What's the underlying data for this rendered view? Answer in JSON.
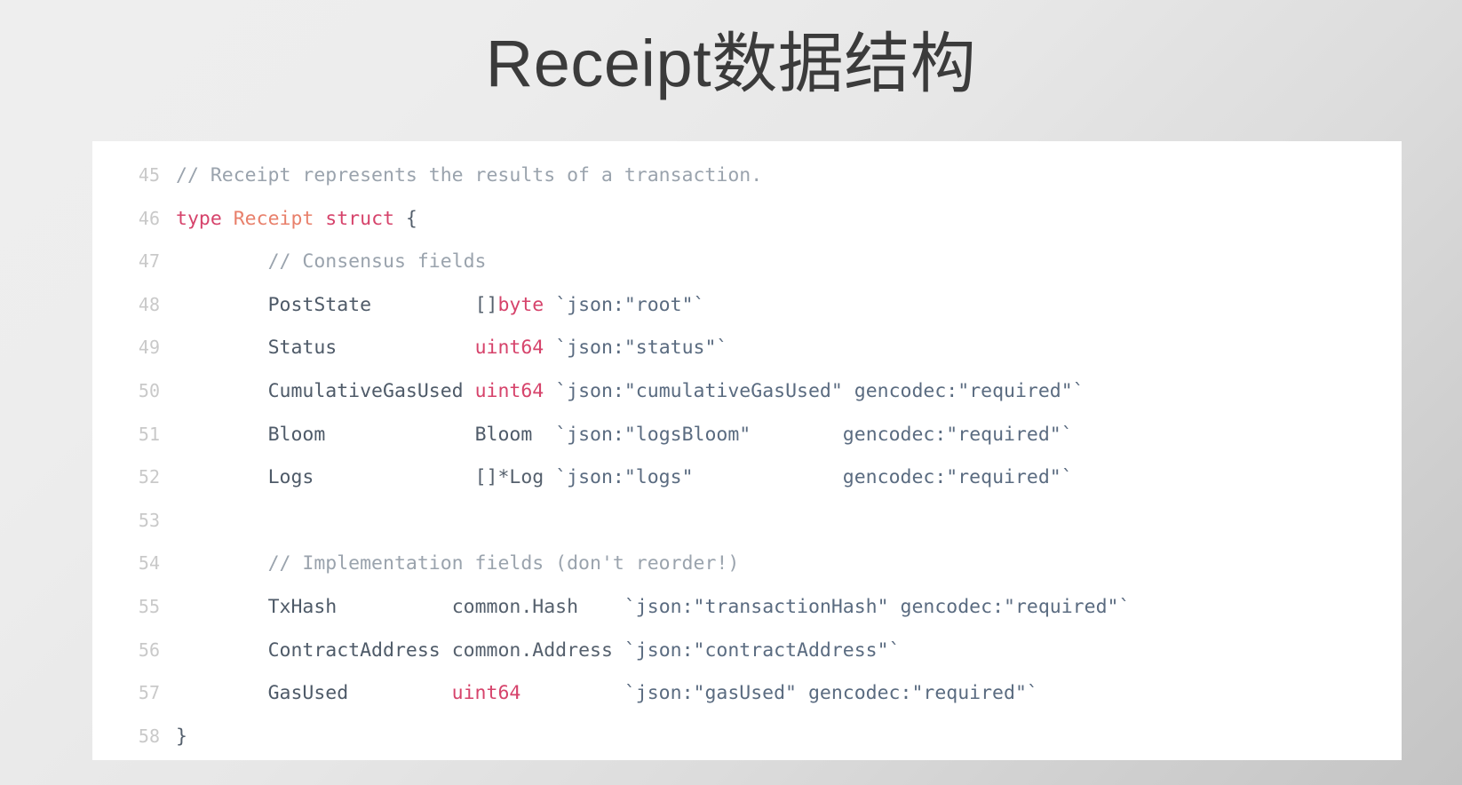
{
  "slide": {
    "title": "Receipt数据结构",
    "title_color": "#3b3b3b",
    "background_from": "#eeeeee",
    "background_to": "#c4c4c4"
  },
  "code_block": {
    "language": "go",
    "panel_color": "#ffffff",
    "gutter_color": "#c9c9c9",
    "colors": {
      "comment": "#9aa3ad",
      "keyword": "#d6436b",
      "type": "#d6436b",
      "field": "#e8806b",
      "string": "#5a6b80",
      "punct": "#55606d"
    },
    "first_line_number": 45,
    "lines": [
      {
        "number": "45",
        "text": "// Receipt represents the results of a transaction.",
        "tokens": [
          {
            "t": "// Receipt represents the results of a transaction.",
            "c": "comment"
          }
        ]
      },
      {
        "number": "46",
        "text": "type Receipt struct {",
        "tokens": [
          {
            "t": "type",
            "c": "keyword"
          },
          {
            "t": " ",
            "c": "plain"
          },
          {
            "t": "Receipt",
            "c": "name"
          },
          {
            "t": " ",
            "c": "plain"
          },
          {
            "t": "struct",
            "c": "keyword"
          },
          {
            "t": " ",
            "c": "plain"
          },
          {
            "t": "{",
            "c": "punct"
          }
        ]
      },
      {
        "number": "47",
        "text": "        // Consensus fields",
        "tokens": [
          {
            "t": "        ",
            "c": "plain"
          },
          {
            "t": "// Consensus fields",
            "c": "comment"
          }
        ]
      },
      {
        "number": "48",
        "text": "        PostState         []byte `json:\"root\"`",
        "tokens": [
          {
            "t": "        ",
            "c": "plain"
          },
          {
            "t": "PostState",
            "c": "field"
          },
          {
            "t": "         ",
            "c": "plain"
          },
          {
            "t": "[]",
            "c": "punct"
          },
          {
            "t": "byte",
            "c": "type"
          },
          {
            "t": " ",
            "c": "plain"
          },
          {
            "t": "`json:\"root\"`",
            "c": "string"
          }
        ]
      },
      {
        "number": "49",
        "text": "        Status            uint64 `json:\"status\"`",
        "tokens": [
          {
            "t": "        ",
            "c": "plain"
          },
          {
            "t": "Status",
            "c": "field"
          },
          {
            "t": "            ",
            "c": "plain"
          },
          {
            "t": "uint64",
            "c": "type"
          },
          {
            "t": " ",
            "c": "plain"
          },
          {
            "t": "`json:\"status\"`",
            "c": "string"
          }
        ]
      },
      {
        "number": "50",
        "text": "        CumulativeGasUsed uint64 `json:\"cumulativeGasUsed\" gencodec:\"required\"`",
        "tokens": [
          {
            "t": "        ",
            "c": "plain"
          },
          {
            "t": "CumulativeGasUsed",
            "c": "field"
          },
          {
            "t": " ",
            "c": "plain"
          },
          {
            "t": "uint64",
            "c": "type"
          },
          {
            "t": " ",
            "c": "plain"
          },
          {
            "t": "`json:\"cumulativeGasUsed\" gencodec:\"required\"`",
            "c": "string"
          }
        ]
      },
      {
        "number": "51",
        "text": "        Bloom             Bloom  `json:\"logsBloom\"        gencodec:\"required\"`",
        "tokens": [
          {
            "t": "        ",
            "c": "plain"
          },
          {
            "t": "Bloom",
            "c": "field"
          },
          {
            "t": "             ",
            "c": "plain"
          },
          {
            "t": "Bloom",
            "c": "field"
          },
          {
            "t": "  ",
            "c": "plain"
          },
          {
            "t": "`json:\"logsBloom\"        gencodec:\"required\"`",
            "c": "string"
          }
        ]
      },
      {
        "number": "52",
        "text": "        Logs              []*Log `json:\"logs\"             gencodec:\"required\"`",
        "tokens": [
          {
            "t": "        ",
            "c": "plain"
          },
          {
            "t": "Logs",
            "c": "field"
          },
          {
            "t": "              ",
            "c": "plain"
          },
          {
            "t": "[]*Log",
            "c": "punct"
          },
          {
            "t": " ",
            "c": "plain"
          },
          {
            "t": "`json:\"logs\"             gencodec:\"required\"`",
            "c": "string"
          }
        ]
      },
      {
        "number": "53",
        "text": "",
        "tokens": []
      },
      {
        "number": "54",
        "text": "        // Implementation fields (don't reorder!)",
        "tokens": [
          {
            "t": "        ",
            "c": "plain"
          },
          {
            "t": "// Implementation fields (don't reorder!)",
            "c": "comment"
          }
        ]
      },
      {
        "number": "55",
        "text": "        TxHash          common.Hash    `json:\"transactionHash\" gencodec:\"required\"`",
        "tokens": [
          {
            "t": "        ",
            "c": "plain"
          },
          {
            "t": "TxHash",
            "c": "field"
          },
          {
            "t": "          ",
            "c": "plain"
          },
          {
            "t": "common.Hash",
            "c": "punct"
          },
          {
            "t": "    ",
            "c": "plain"
          },
          {
            "t": "`json:\"transactionHash\" gencodec:\"required\"`",
            "c": "string"
          }
        ]
      },
      {
        "number": "56",
        "text": "        ContractAddress common.Address `json:\"contractAddress\"`",
        "tokens": [
          {
            "t": "        ",
            "c": "plain"
          },
          {
            "t": "ContractAddress",
            "c": "field"
          },
          {
            "t": " ",
            "c": "plain"
          },
          {
            "t": "common.Address",
            "c": "punct"
          },
          {
            "t": " ",
            "c": "plain"
          },
          {
            "t": "`json:\"contractAddress\"`",
            "c": "string"
          }
        ]
      },
      {
        "number": "57",
        "text": "        GasUsed         uint64         `json:\"gasUsed\" gencodec:\"required\"`",
        "tokens": [
          {
            "t": "        ",
            "c": "plain"
          },
          {
            "t": "GasUsed",
            "c": "field"
          },
          {
            "t": "         ",
            "c": "plain"
          },
          {
            "t": "uint64",
            "c": "type"
          },
          {
            "t": "         ",
            "c": "plain"
          },
          {
            "t": "`json:\"gasUsed\" gencodec:\"required\"`",
            "c": "string"
          }
        ]
      },
      {
        "number": "58",
        "text": "}",
        "tokens": [
          {
            "t": "}",
            "c": "punct"
          }
        ]
      }
    ]
  }
}
